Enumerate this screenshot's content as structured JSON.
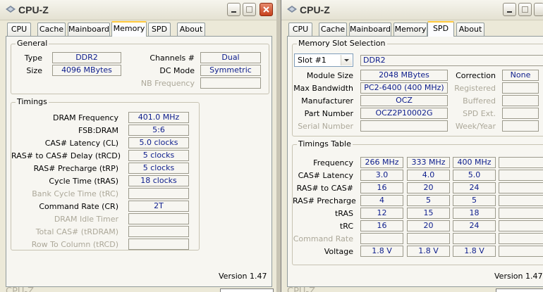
{
  "left_window": {
    "title": "CPU-Z",
    "tabs": [
      "CPU",
      "Cache",
      "Mainboard",
      "Memory",
      "SPD",
      "About"
    ],
    "active_tab": "Memory",
    "general": {
      "title": "General",
      "type_label": "Type",
      "type_value": "DDR2",
      "size_label": "Size",
      "size_value": "4096 MBytes",
      "channels_label": "Channels #",
      "channels_value": "Dual",
      "dcmode_label": "DC Mode",
      "dcmode_value": "Symmetric",
      "nbfreq_label": "NB Frequency"
    },
    "timings": {
      "title": "Timings",
      "rows": [
        {
          "label": "DRAM Frequency",
          "value": "401.0 MHz",
          "disabled": false
        },
        {
          "label": "FSB:DRAM",
          "value": "5:6",
          "disabled": false
        },
        {
          "label": "CAS# Latency (CL)",
          "value": "5.0 clocks",
          "disabled": false
        },
        {
          "label": "RAS# to CAS# Delay (tRCD)",
          "value": "5 clocks",
          "disabled": false
        },
        {
          "label": "RAS# Precharge (tRP)",
          "value": "5 clocks",
          "disabled": false
        },
        {
          "label": "Cycle Time (tRAS)",
          "value": "18 clocks",
          "disabled": false
        },
        {
          "label": "Bank Cycle Time (tRC)",
          "value": "",
          "disabled": true
        },
        {
          "label": "Command Rate (CR)",
          "value": "2T",
          "disabled": false
        },
        {
          "label": "DRAM Idle Timer",
          "value": "",
          "disabled": true
        },
        {
          "label": "Total CAS# (tRDRAM)",
          "value": "",
          "disabled": true
        },
        {
          "label": "Row To Column (tRCD)",
          "value": "",
          "disabled": true
        }
      ]
    },
    "version": "Version 1.47"
  },
  "right_window": {
    "title": "CPU-Z",
    "tabs": [
      "CPU",
      "Cache",
      "Mainboard",
      "Memory",
      "SPD",
      "About"
    ],
    "active_tab": "SPD",
    "slot_selection": {
      "title": "Memory Slot Selection",
      "slot_value": "Slot #1",
      "slot_type": "DDR2"
    },
    "module": {
      "module_size_label": "Module Size",
      "module_size_value": "2048 MBytes",
      "max_bw_label": "Max Bandwidth",
      "max_bw_value": "PC2-6400 (400 MHz)",
      "manufacturer_label": "Manufacturer",
      "manufacturer_value": "OCZ",
      "part_label": "Part Number",
      "part_value": "OCZ2P10002G",
      "serial_label": "Serial Number",
      "correction_label": "Correction",
      "correction_value": "None",
      "registered_label": "Registered",
      "buffered_label": "Buffered",
      "spdext_label": "SPD Ext.",
      "weekyear_label": "Week/Year"
    },
    "timings_table": {
      "title": "Timings Table",
      "rows": [
        {
          "label": "Frequency",
          "values": [
            "266 MHz",
            "333 MHz",
            "400 MHz",
            ""
          ],
          "disabled": false
        },
        {
          "label": "CAS# Latency",
          "values": [
            "3.0",
            "4.0",
            "5.0",
            ""
          ],
          "disabled": false
        },
        {
          "label": "RAS# to CAS#",
          "values": [
            "16",
            "20",
            "24",
            ""
          ],
          "disabled": false
        },
        {
          "label": "RAS# Precharge",
          "values": [
            "4",
            "5",
            "5",
            ""
          ],
          "disabled": false
        },
        {
          "label": "tRAS",
          "values": [
            "12",
            "15",
            "18",
            ""
          ],
          "disabled": false
        },
        {
          "label": "tRC",
          "values": [
            "16",
            "20",
            "24",
            ""
          ],
          "disabled": false
        },
        {
          "label": "Command Rate",
          "values": [
            "",
            "",
            "",
            ""
          ],
          "disabled": true
        },
        {
          "label": "Voltage",
          "values": [
            "1.8 V",
            "1.8 V",
            "1.8 V",
            ""
          ],
          "disabled": false
        }
      ]
    },
    "version": "Version 1.47"
  },
  "colors": {
    "value_text": "#0d1d8c",
    "active_tab_accent": "#ffc83c",
    "close_button": "#c6401c"
  }
}
